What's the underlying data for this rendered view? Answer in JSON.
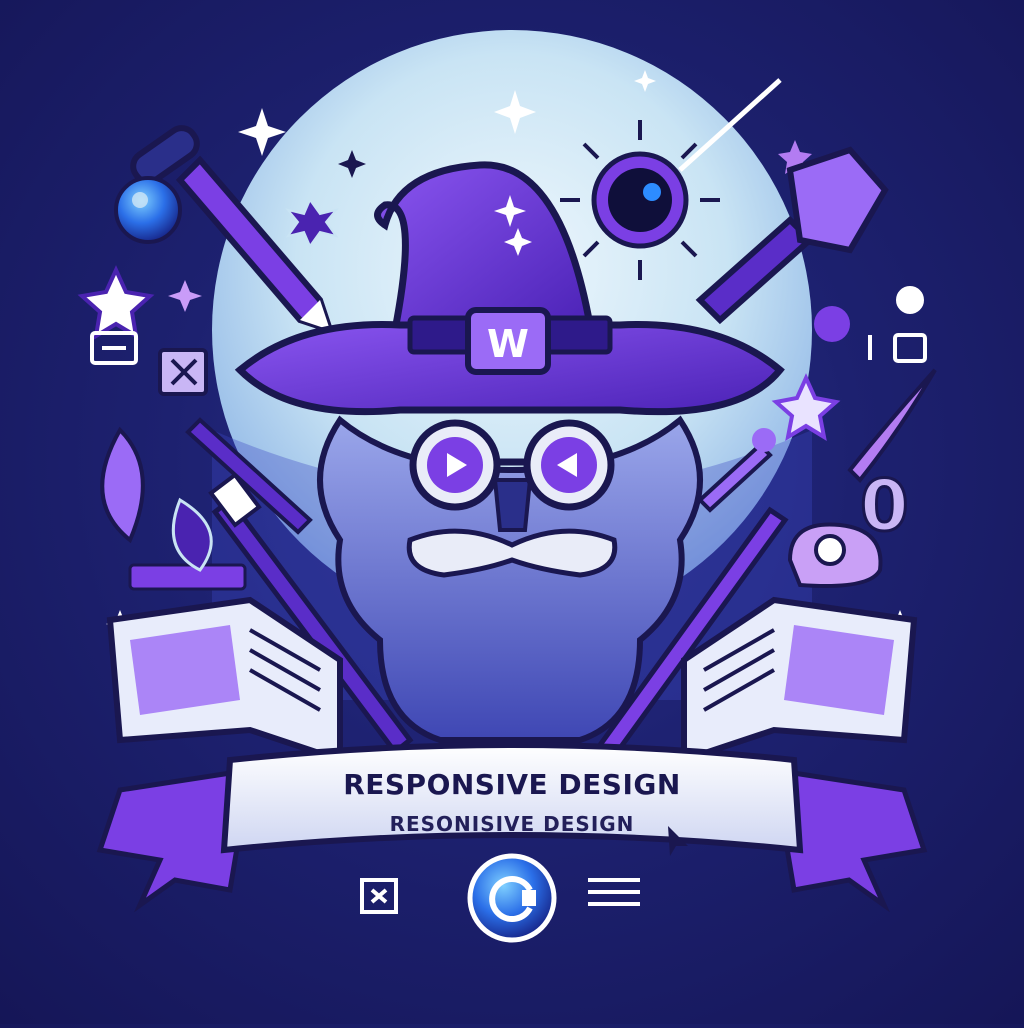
{
  "hat_badge_letter": "W",
  "banner": {
    "title": "RESPONSIVE DESIGN",
    "subtitle": "RESONISIVE DESIGN"
  },
  "colors": {
    "background": "#1d2170",
    "moon": "#cfe6f5",
    "purple": "#7b3fe4",
    "deep_purple": "#4a23b0",
    "beard": "#6f7fd6",
    "ribbon": "#e9ecf8",
    "accent_blue": "#2d8cff"
  },
  "icons": [
    "wizard-hat-icon",
    "magic-wand-icon",
    "paintbrush-icon",
    "quill-icon",
    "open-book-icon",
    "star-icon",
    "sparkle-icon",
    "crystal-orb-icon",
    "leaf-icon",
    "play-icon",
    "refresh-icon",
    "cursor-icon"
  ]
}
